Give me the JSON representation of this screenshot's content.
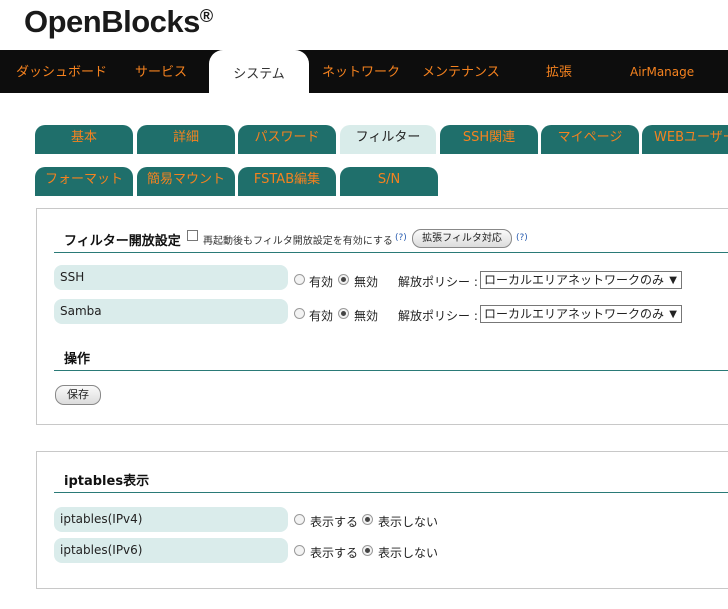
{
  "logo": {
    "text": "OpenBlocks",
    "mark": "®"
  },
  "nav": {
    "items": [
      {
        "label": "ダッシュボード"
      },
      {
        "label": "サービス"
      },
      {
        "label": "システム"
      },
      {
        "label": "ネットワーク"
      },
      {
        "label": "メンテナンス"
      },
      {
        "label": "拡張"
      },
      {
        "label": "AirManage"
      }
    ],
    "active_index": 2
  },
  "tabs": {
    "row1": [
      "基本",
      "詳細",
      "パスワード",
      "フィルター",
      "SSH関連",
      "マイページ",
      "WEBユーザー"
    ],
    "row2": [
      "フォーマット",
      "簡易マウント",
      "FSTAB編集",
      "S/N"
    ],
    "active": "フィルター"
  },
  "filter": {
    "title": "フィルター開放設定",
    "restart_checkbox_label": "再起動後もフィルタ開放設定を有効にする",
    "help": "(?)",
    "ext_button": "拡張フィルタ対応",
    "rows": [
      {
        "label": "SSH",
        "on": "有効",
        "off": "無効",
        "selected": "off",
        "policy_label": "解放ポリシー :",
        "policy": "ローカルエリアネットワークのみ"
      },
      {
        "label": "Samba",
        "on": "有効",
        "off": "無効",
        "selected": "off",
        "policy_label": "解放ポリシー :",
        "policy": "ローカルエリアネットワークのみ"
      }
    ],
    "ops_title": "操作",
    "save_button": "保存"
  },
  "iptables": {
    "title": "iptables表示",
    "rows": [
      {
        "label": "iptables(IPv4)",
        "show": "表示する",
        "hide": "表示しない",
        "selected": "hide"
      },
      {
        "label": "iptables(IPv6)",
        "show": "表示する",
        "hide": "表示しない",
        "selected": "hide"
      }
    ]
  },
  "colors": {
    "accent": "#f5821f",
    "tab": "#1f6f6b",
    "tab_active": "#d9ecea",
    "label_bg": "#daeceb",
    "navbar": "#0d0d0d"
  }
}
